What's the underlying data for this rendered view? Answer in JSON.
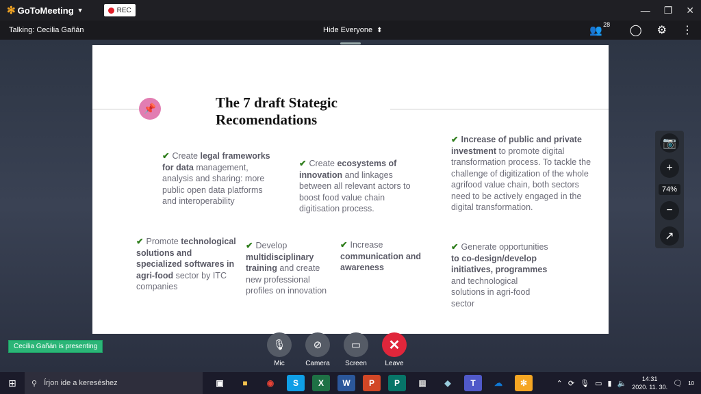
{
  "titlebar": {
    "app_name": "GoToMeeting",
    "rec_label": "REC"
  },
  "topbar": {
    "talking": "Talking: Cecilia Gañán",
    "hide_everyone": "Hide Everyone",
    "participant_count": "28"
  },
  "slide": {
    "title_line1": "The 7 draft Stategic",
    "title_line2": "Recomendations",
    "recommendations": [
      {
        "pre": "Create ",
        "bold": "legal frameworks for data",
        "post": " management, analysis and sharing: more public open data platforms and interoperability"
      },
      {
        "pre": "Create ",
        "bold": "ecosystems of innovation",
        "post": " and linkages between all relevant actors to boost food value chain digitisation process."
      },
      {
        "pre": "",
        "bold": "Increase of public and private investment",
        "post": " to promote digital transformation process. To tackle the challenge of digitization of the whole agrifood value chain, both sectors need to be actively engaged in the digital transformation."
      },
      {
        "pre": "Promote ",
        "bold": "technological solutions and specialized softwares in agri-food",
        "post": " sector by ITC companies"
      },
      {
        "pre": "Develop ",
        "bold": "multidisciplinary training",
        "post": " and create new professional profiles on innovation"
      },
      {
        "pre": "Increase ",
        "bold": "communication and awareness",
        "post": ""
      },
      {
        "pre": "Generate opportunities ",
        "bold": "to co-design/develop initiatives, programmes",
        "post": " and technological solutions in agri-food sector"
      }
    ]
  },
  "side_controls": {
    "zoom": "74%"
  },
  "presenting_label": "Cecilia Gañán is presenting",
  "controls": {
    "mic": "Mic",
    "camera": "Camera",
    "screen": "Screen",
    "leave": "Leave"
  },
  "taskbar": {
    "search_placeholder": "Írjon ide a kereséshez",
    "time": "14:31",
    "date": "2020. 11. 30.",
    "notifications": "10"
  }
}
